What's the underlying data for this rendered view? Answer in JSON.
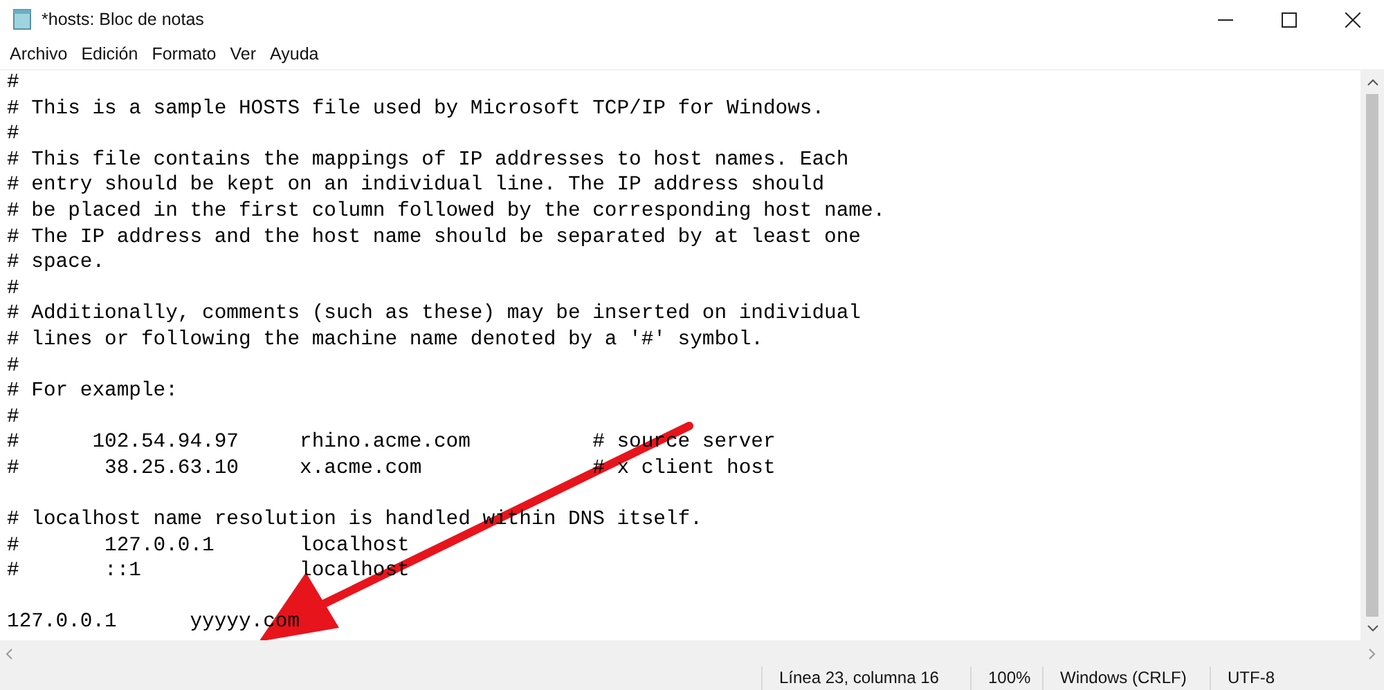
{
  "window": {
    "title": "*hosts: Bloc de notas"
  },
  "menu": [
    "Archivo",
    "Edición",
    "Formato",
    "Ver",
    "Ayuda"
  ],
  "editor": {
    "blocks": [
      [
        "#",
        "# This is a sample HOSTS file used by Microsoft TCP/IP for Windows.",
        "#",
        "# This file contains the mappings of IP addresses to host names. Each",
        "# entry should be kept on an individual line. The IP address should",
        "# be placed in the first column followed by the corresponding host name.",
        "# The IP address and the host name should be separated by at least one",
        "# space.",
        "#",
        "# Additionally, comments (such as these) may be inserted on individual",
        "# lines or following the machine name denoted by a '#' symbol.",
        "#",
        "# For example:",
        "#",
        "#      102.54.94.97     rhino.acme.com          # source server",
        "#       38.25.63.10     x.acme.com              # x client host"
      ],
      [
        "# localhost name resolution is handled within DNS itself.",
        "#       127.0.0.1       localhost",
        "#       ::1             localhost"
      ],
      [
        "127.0.0.1      yyyyy.com"
      ]
    ]
  },
  "status_bar": [
    "Línea 23, columna 16",
    "100%",
    "Windows (CRLF)",
    "UTF-8"
  ]
}
